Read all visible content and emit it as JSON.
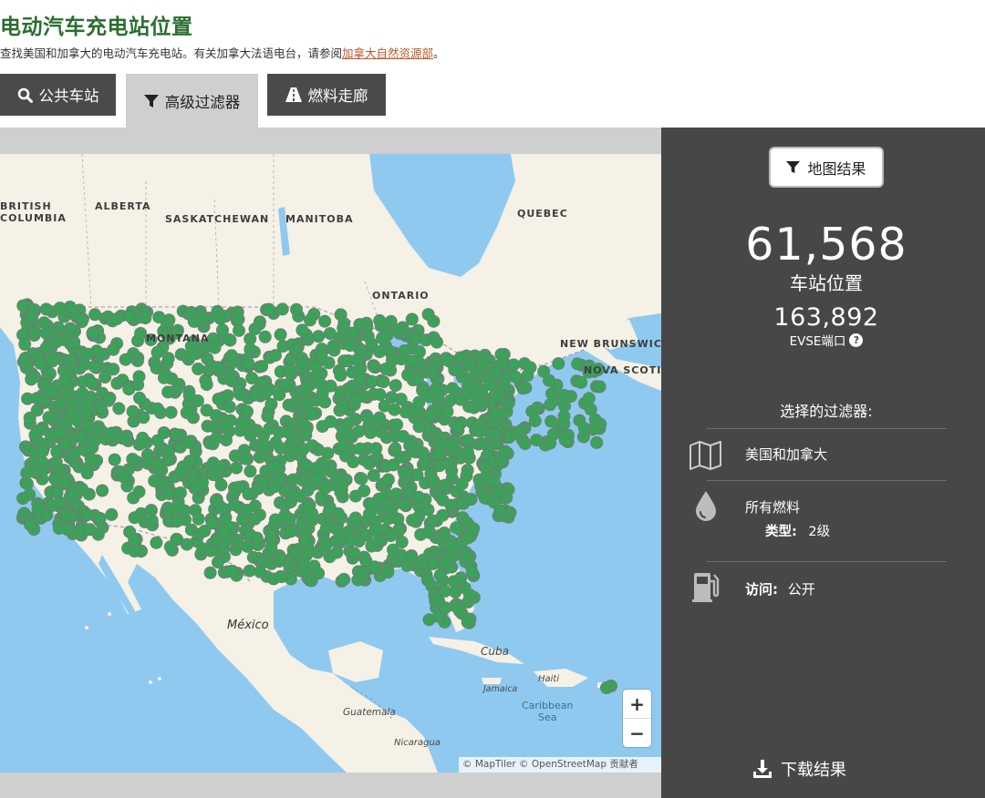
{
  "header": {
    "title": "电动汽车充电站位置",
    "subtitle_text": "查找美国和加拿大的电动汽车充电站。有关加拿大法语电台，请参阅",
    "subtitle_link": "加拿大自然资源部",
    "subtitle_end": "。"
  },
  "tabs": [
    {
      "label": "公共车站",
      "icon": "search-icon"
    },
    {
      "label": "高级过滤器",
      "icon": "filter-icon"
    },
    {
      "label": "燃料走廊",
      "icon": "road-icon"
    }
  ],
  "map": {
    "labels": {
      "british_columbia": "BRITISH\nCOLUMBIA",
      "alberta": "ALBERTA",
      "saskatchewan": "SASKATCHEWAN",
      "manitoba": "MANITOBA",
      "quebec": "QUEBEC",
      "ontario": "ONTARIO",
      "montana": "MONTANA",
      "new_brunswick": "NEW BRUNSWICK",
      "nova_scotia": "NOVA SCOTIA",
      "mexico": "México",
      "cuba": "Cuba",
      "jamaica": "Jamaica",
      "haiti": "Haiti",
      "caribbean_sea": "Caribbean\nSea",
      "guatemala": "Guatemala",
      "nicaragua": "Nicaragua"
    },
    "zoom_in": "+",
    "zoom_out": "−",
    "attribution": "© MapTiler © OpenStreetMap 贡献者",
    "station_color": "#3aa35a"
  },
  "panel": {
    "map_results_button": "地图结果",
    "station_count": "61,568",
    "station_label": "车站位置",
    "ports_count": "163,892",
    "ports_label": "EVSE端口",
    "filters_title": "选择的过滤器:",
    "filters": {
      "location": "美国和加拿大",
      "fuel": "所有燃料",
      "type_label": "类型:",
      "type_value": "2级",
      "access_label": "访问:",
      "access_value": "公开"
    },
    "download": "下载结果"
  }
}
